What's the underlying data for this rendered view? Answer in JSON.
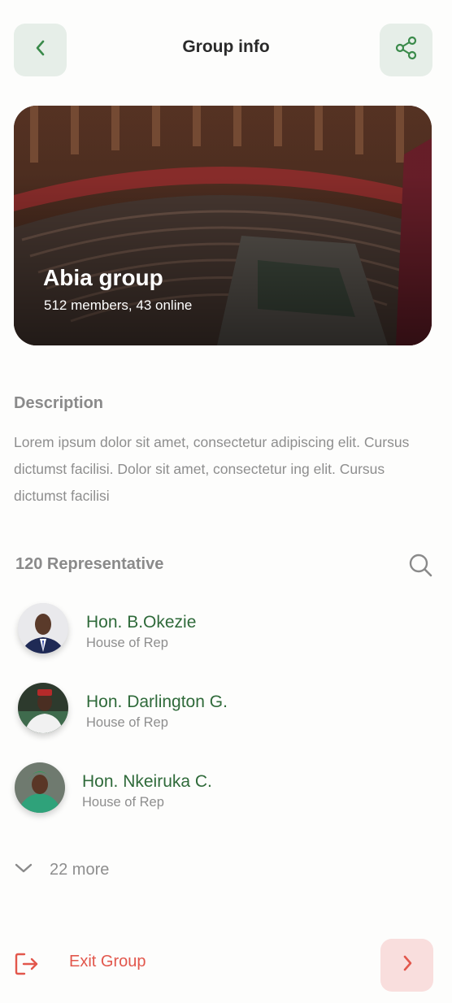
{
  "header": {
    "title": "Group info",
    "back_icon": "chevron-left-icon",
    "share_icon": "share-icon"
  },
  "group": {
    "name": "Abia group",
    "meta": "512 members, 43 online",
    "image": "parliament-chamber-photo"
  },
  "description": {
    "heading": "Description",
    "text": "Lorem ipsum dolor sit amet, consectetur adipiscing elit. Cursus dictumst facilisi. Dolor sit amet, consectetur ing elit. Cursus dictumst facilisi"
  },
  "representatives": {
    "heading": "120 Representative",
    "search_icon": "search-icon",
    "items": [
      {
        "name": "Hon. B.Okezie",
        "role": "House of Rep"
      },
      {
        "name": "Hon. Darlington G.",
        "role": "House of Rep"
      },
      {
        "name": "Hon. Nkeiruka C.",
        "role": "House of Rep"
      }
    ],
    "more_label": "22 more"
  },
  "exit": {
    "label": "Exit Group",
    "icon": "logout-icon",
    "go_icon": "chevron-right-icon"
  },
  "colors": {
    "accent_green": "#3a8a4a",
    "danger_red": "#e2574c",
    "icon_btn_bg": "#e6eee8",
    "danger_bg": "#f9dedd"
  }
}
